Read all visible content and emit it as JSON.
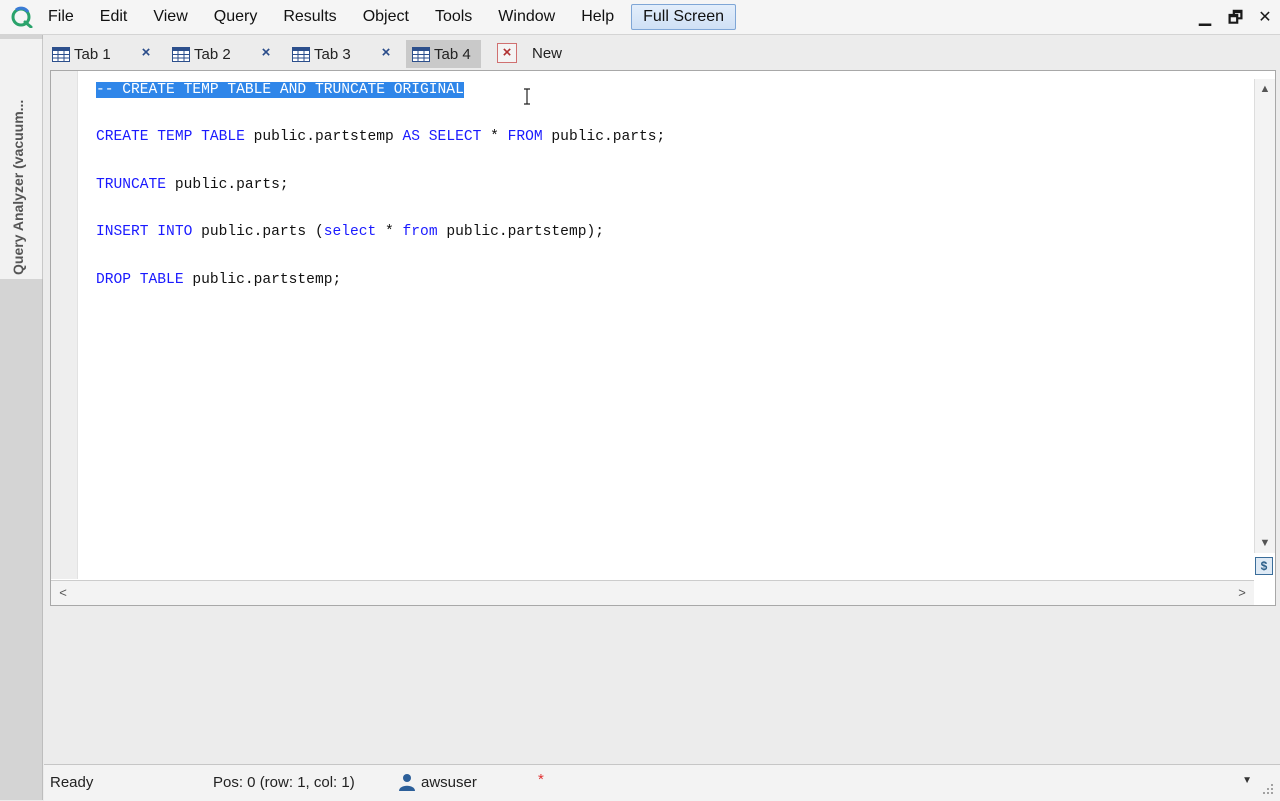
{
  "menu": {
    "items": [
      "File",
      "Edit",
      "View",
      "Query",
      "Results",
      "Object",
      "Tools",
      "Window",
      "Help"
    ],
    "full_screen": "Full Screen"
  },
  "window_controls": {
    "minimize": "▁",
    "restore": "🗗",
    "close": "✕"
  },
  "side_panel": {
    "label": "Query Analyzer (vacuum..."
  },
  "tabs": [
    {
      "label": "Tab 1",
      "close": "×"
    },
    {
      "label": "Tab 2",
      "close": "×"
    },
    {
      "label": "Tab 3",
      "close": "×"
    },
    {
      "label": "Tab 4",
      "close": "×"
    },
    {
      "label": "New"
    }
  ],
  "editor": {
    "line1": "-- CREATE TEMP TABLE AND TRUNCATE ORIGINAL",
    "line2": {
      "kw1": "CREATE TEMP TABLE",
      "t1": " public.partstemp ",
      "kw2": "AS SELECT",
      "t2": " * ",
      "kw3": "FROM",
      "t3": " public.parts;"
    },
    "line3": {
      "kw1": "TRUNCATE",
      "t1": " public.parts;"
    },
    "line4": {
      "kw1": "INSERT INTO",
      "t1": " public.parts (",
      "kw2": "select",
      "t2": " * ",
      "kw3": "from",
      "t3": " public.partstemp);"
    },
    "line5": {
      "kw1": "DROP TABLE",
      "t1": " public.partstemp;"
    },
    "scroll_up": "▲",
    "scroll_down": "▼",
    "scroll_left": "<",
    "scroll_right": ">",
    "dollar_button": "$"
  },
  "status": {
    "ready": "Ready",
    "position": "Pos: 0 (row: 1, col: 1)",
    "user": "awsuser",
    "modified": "*",
    "dropdown": "▼"
  },
  "colors": {
    "keyword": "#1a1aff",
    "selection": "#2f86e9",
    "accent": "#7fa6d6",
    "modified": "#e03030"
  }
}
